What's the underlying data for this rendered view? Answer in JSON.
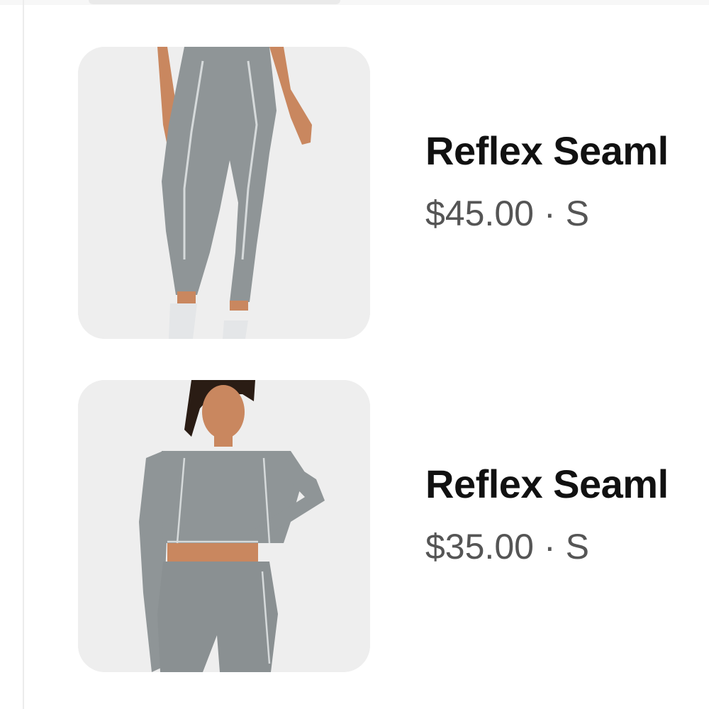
{
  "listing": {
    "items": [
      {
        "image_icon": "product-photo-leggings",
        "title": "Reflex Seaml",
        "price": "$45.00",
        "separator": "·",
        "size": "S"
      },
      {
        "image_icon": "product-photo-top-and-shorts",
        "title": "Reflex Seaml",
        "price": "$35.00",
        "separator": "·",
        "size": "S"
      }
    ]
  },
  "colors": {
    "garment": "#8f9597",
    "skin": "#c9875f",
    "thumb_bg": "#eeeeee",
    "title": "#111111",
    "meta": "#555555"
  }
}
